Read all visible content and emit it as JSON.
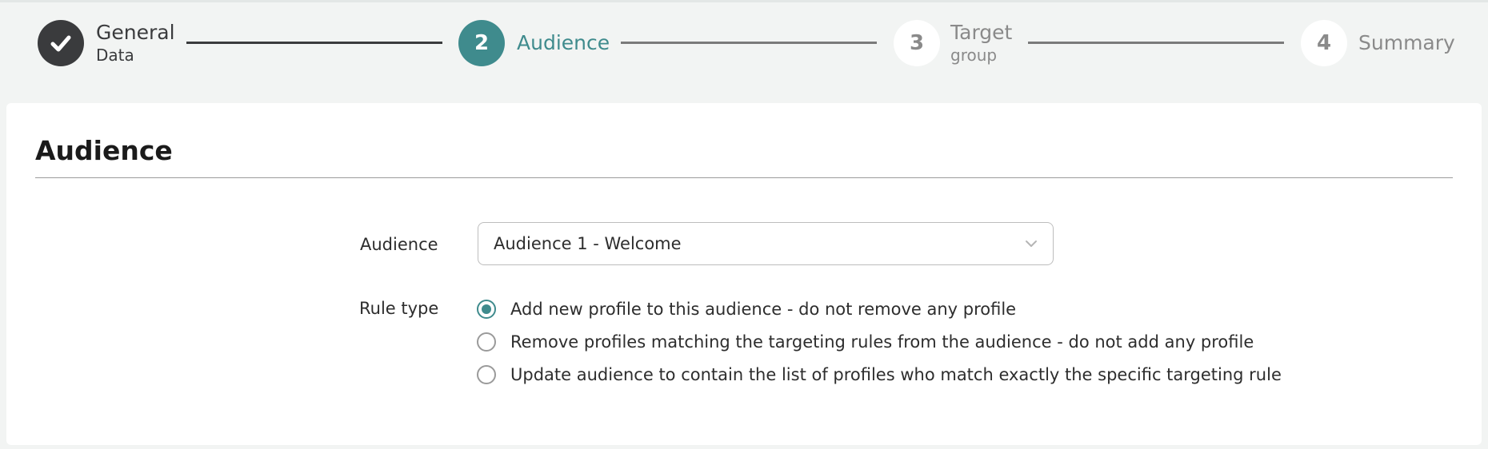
{
  "colors": {
    "accent": "#3f8b8d",
    "completed": "#3a3b3d",
    "inactive_text": "#8a8a8a",
    "page_background": "#f2f4f3"
  },
  "stepper": {
    "steps": [
      {
        "status": "completed",
        "icon": "checkmark-icon",
        "title": "General",
        "subtitle": "Data"
      },
      {
        "status": "active",
        "number": "2",
        "title": "Audience",
        "subtitle": ""
      },
      {
        "status": "pending",
        "number": "3",
        "title": "Target",
        "subtitle": "group"
      },
      {
        "status": "pending",
        "number": "4",
        "title": "Summary",
        "subtitle": ""
      }
    ]
  },
  "form": {
    "title": "Audience",
    "audience_label": "Audience",
    "audience_value": "Audience 1 - Welcome",
    "rule_type_label": "Rule type",
    "rule_options": [
      {
        "label": "Add new profile to this audience - do not remove any profile",
        "selected": true
      },
      {
        "label": "Remove profiles matching the targeting rules from the audience - do not add any profile",
        "selected": false
      },
      {
        "label": "Update audience to contain the list of profiles who match exactly the specific targeting rule",
        "selected": false
      }
    ]
  }
}
